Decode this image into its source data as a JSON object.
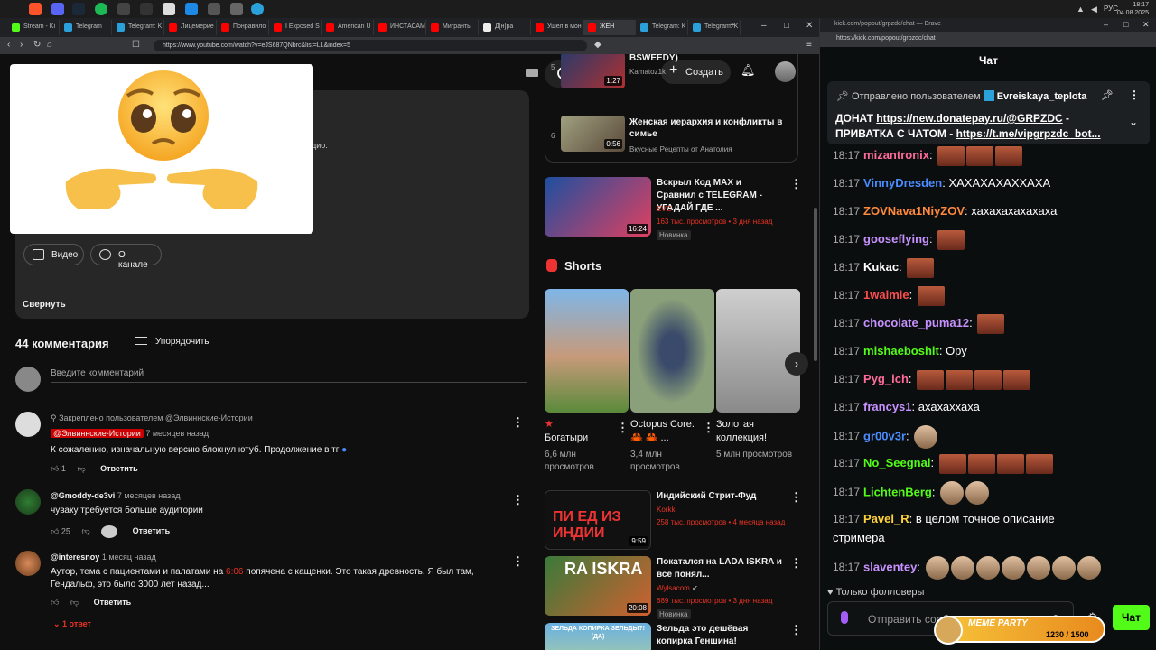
{
  "taskbar": {
    "time": "18:17",
    "date": "04.08.2025",
    "lang": "РУС"
  },
  "browser": {
    "tabs": [
      {
        "label": "Stream - Ki",
        "color": "#53fc18",
        "active": false
      },
      {
        "label": "Telegram",
        "color": "#2aa1da",
        "active": false
      },
      {
        "label": "Telegram: K",
        "color": "#2aa1da",
        "active": false
      },
      {
        "label": "Лицемерие",
        "color": "#ff0000",
        "active": false
      },
      {
        "label": "Понравило",
        "color": "#ff0000",
        "active": false
      },
      {
        "label": "I Exposed S",
        "color": "#ff0000",
        "active": false
      },
      {
        "label": "American U",
        "color": "#ff0000",
        "active": false
      },
      {
        "label": "ИНСТАСАМ",
        "color": "#ff0000",
        "active": false
      },
      {
        "label": "Мигранты",
        "color": "#ff0000",
        "active": false
      },
      {
        "label": "Д[н]ра",
        "color": "#eeeeee",
        "active": false
      },
      {
        "label": "Ушел в мон",
        "color": "#ff0000",
        "active": false
      },
      {
        "label": "ЖЕН",
        "color": "#ff0000",
        "active": true
      },
      {
        "label": "Telegram: K",
        "color": "#2aa1da",
        "active": false
      },
      {
        "label": "Telegram: K",
        "color": "#2aa1da",
        "active": false
      }
    ],
    "url": "https://www.youtube.com/watch?v=eJS687QNbrc&list=LL&index=5"
  },
  "youtube": {
    "create_label": "Создать",
    "desc_fragment": "дио.",
    "chip_video": "Видео",
    "chip_channel": "О канале",
    "collapse": "Свернуть",
    "comments_count": "44 комментария",
    "sort_label": "Упорядочить",
    "comment_placeholder": "Введите комментарий",
    "comments": [
      {
        "pinned_by": "Закреплено пользователем @Элвиннские-Истории",
        "author": "@Элвиннские-Истории",
        "time": "7 месяцев назад",
        "text": "К сожалению, изначальную версию блокнул ютуб. Продолжение в тг",
        "likes": "1",
        "reply": "Ответить"
      },
      {
        "author": "@Gmoddy-de3vi",
        "time": "7 месяцев назад",
        "text": "чуваку требуется больше аудитории",
        "likes": "25",
        "reply": "Ответить"
      },
      {
        "author": "@interesnoy",
        "time": "1 месяц назад",
        "text_a": "Аутор, тема с пациентами и палатами на ",
        "timestamp": "6:06",
        "text_b": " попячена с кащенки. Это такая древность. Я был там,",
        "text_line2": "Гендальф, это было 3000 лет назад...",
        "reply": "Ответить",
        "replies": "1 ответ"
      }
    ],
    "playlist": [
      {
        "num": "5",
        "title": "BSWEEDY)",
        "channel": "Kamatoz1k",
        "duration": "1:27"
      },
      {
        "num": "6",
        "title": "Женская иерархия и конфликты в симье",
        "channel": "Вкусные Рецепты от Анатолия",
        "duration": "0:56"
      }
    ],
    "recommended": [
      {
        "title": "Вскрыл Код MAX и Сравнил с TELEGRAM - УГАДАЙ ГДЕ ...",
        "channel": "EVG",
        "stats": "163 тыс. просмотров • 3 дня назад",
        "badge": "Новинка",
        "duration": "16:24"
      }
    ],
    "shorts_title": "Shorts",
    "shorts": [
      {
        "title": "Богатыри",
        "views": "6,6 млн просмотров"
      },
      {
        "title": "Octopus Core. 🦀 🦀 ...",
        "views": "3,4 млн просмотров"
      },
      {
        "title": "Золотая коллекция!",
        "views": "5 млн просмотров"
      }
    ],
    "recommended2": [
      {
        "title": "Индийский Стрит-Фуд",
        "channel": "Korkki",
        "stats": "258 тыс. просмотров • 4 месяца назад",
        "duration": "9:59",
        "thumb_text": "ПИ ЕД ИЗ ИНДИИ"
      },
      {
        "title": "Покатался на LADA ISKRA и всё понял...",
        "channel": "Wylsacom",
        "stats": "689 тыс. просмотров • 3 дня назад",
        "badge": "Новинка",
        "duration": "20:08",
        "thumb_text": "RA ISKRA"
      },
      {
        "title": "Зельда это дешёвая копирка Геншина!",
        "thumb_text": "ЗЕЛЬДА КОПИРКА ЗЕЛЬДЫ?! (ДА)"
      }
    ]
  },
  "kick": {
    "window_title": "kick.com/popout/grpzdc/chat — Brave",
    "url": "https://kick.com/popout/grpzdc/chat",
    "header": "Чат",
    "pinned_prefix": "Отправлено пользователем",
    "pinned_user": "Evreiskaya_teplota",
    "pinned_line1_a": "ДОНАТ ",
    "pinned_link1": "https://new.donatepay.ru/@GRPZDC",
    "pinned_line1_b": " -",
    "pinned_line2_a": "ПРИВАТКА С ЧАТОМ - ",
    "pinned_link2": "https://t.me/vipgrpzdc_bot...",
    "messages": [
      {
        "time": "18:17",
        "user": "mizantronix",
        "color": "#ff6b9a",
        "text": "",
        "emotes": 3
      },
      {
        "time": "18:17",
        "user": "VinnyDresden",
        "color": "#4a8cff",
        "text": "ХАХАХАХАХХАХА",
        "emotes": 0
      },
      {
        "time": "18:17",
        "user": "ZOVNava1NiyZOV",
        "color": "#ff8a3d",
        "text": "хахахахахахаха",
        "emotes": 0
      },
      {
        "time": "18:17",
        "user": "gooseflying",
        "color": "#c792ff",
        "text": "",
        "emotes": 1
      },
      {
        "time": "18:17",
        "user": "Kukac",
        "color": "#ffffff",
        "text": "",
        "emotes": 1
      },
      {
        "time": "18:17",
        "user": "1walmie",
        "color": "#ff4d4d",
        "text": "",
        "emotes": 1
      },
      {
        "time": "18:17",
        "user": "chocolate_puma12",
        "color": "#c792ff",
        "text": "",
        "emotes": 1
      },
      {
        "time": "18:17",
        "user": "mishaeboshit",
        "color": "#53fc18",
        "text": "Ору",
        "emotes": 0
      },
      {
        "time": "18:17",
        "user": "Pyg_ich",
        "color": "#ff6b9a",
        "text": "",
        "emotes": 4
      },
      {
        "time": "18:17",
        "user": "francys1",
        "color": "#c792ff",
        "text": "ахахаххаха",
        "emotes": 0
      },
      {
        "time": "18:17",
        "user": "gr00v3r",
        "color": "#4a8cff",
        "text": "",
        "emotes": 1
      },
      {
        "time": "18:17",
        "user": "No_Seegnal",
        "color": "#53fc18",
        "text": "",
        "emotes": 4
      },
      {
        "time": "18:17",
        "user": "LichtenBerg",
        "color": "#53fc18",
        "text": "",
        "emotes": 2
      },
      {
        "time": "18:17",
        "user": "Pavel_R",
        "color": "#ffd23d",
        "text": "в целом точное описание",
        "emotes": 0
      },
      {
        "time": "18:17",
        "user": "slaventey",
        "color": "#c792ff",
        "text": "",
        "emotes": 7
      }
    ],
    "msg_continuation": "стримера",
    "followers_only": "Только фолловеры",
    "input_placeholder": "Отправить сообщение",
    "send_label": "Чат",
    "meme_party": {
      "label": "MEME PARTY",
      "progress": "1230 / 1500"
    }
  }
}
